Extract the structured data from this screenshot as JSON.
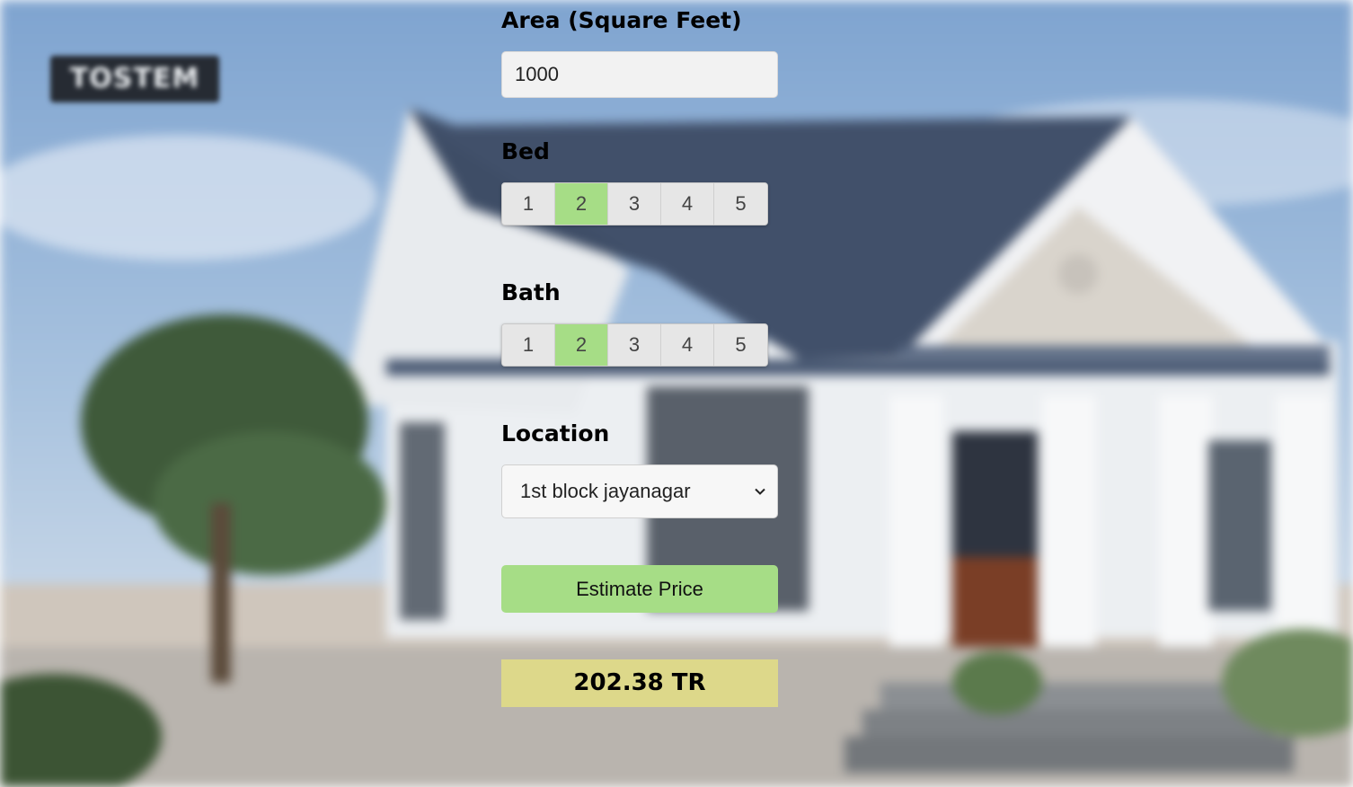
{
  "background": {
    "logo_text": "TOSTEM",
    "colors": {
      "sky": "#8fb0d6",
      "roof": "#3e4d66",
      "wall": "#eef0f3",
      "tree": "#3f5a3a"
    }
  },
  "form": {
    "area": {
      "label": "Area (Square Feet)",
      "value": "1000"
    },
    "bed": {
      "label": "Bed",
      "options": [
        "1",
        "2",
        "3",
        "4",
        "5"
      ],
      "selected": "2"
    },
    "bath": {
      "label": "Bath",
      "options": [
        "1",
        "2",
        "3",
        "4",
        "5"
      ],
      "selected": "2"
    },
    "location": {
      "label": "Location",
      "selected": "1st block jayanagar",
      "icon": "chevron-down-icon"
    },
    "estimate_button": "Estimate Price",
    "result": "202.38 TR"
  },
  "colors": {
    "accent": "#a6dd86",
    "result_bg": "#ddd88a"
  }
}
